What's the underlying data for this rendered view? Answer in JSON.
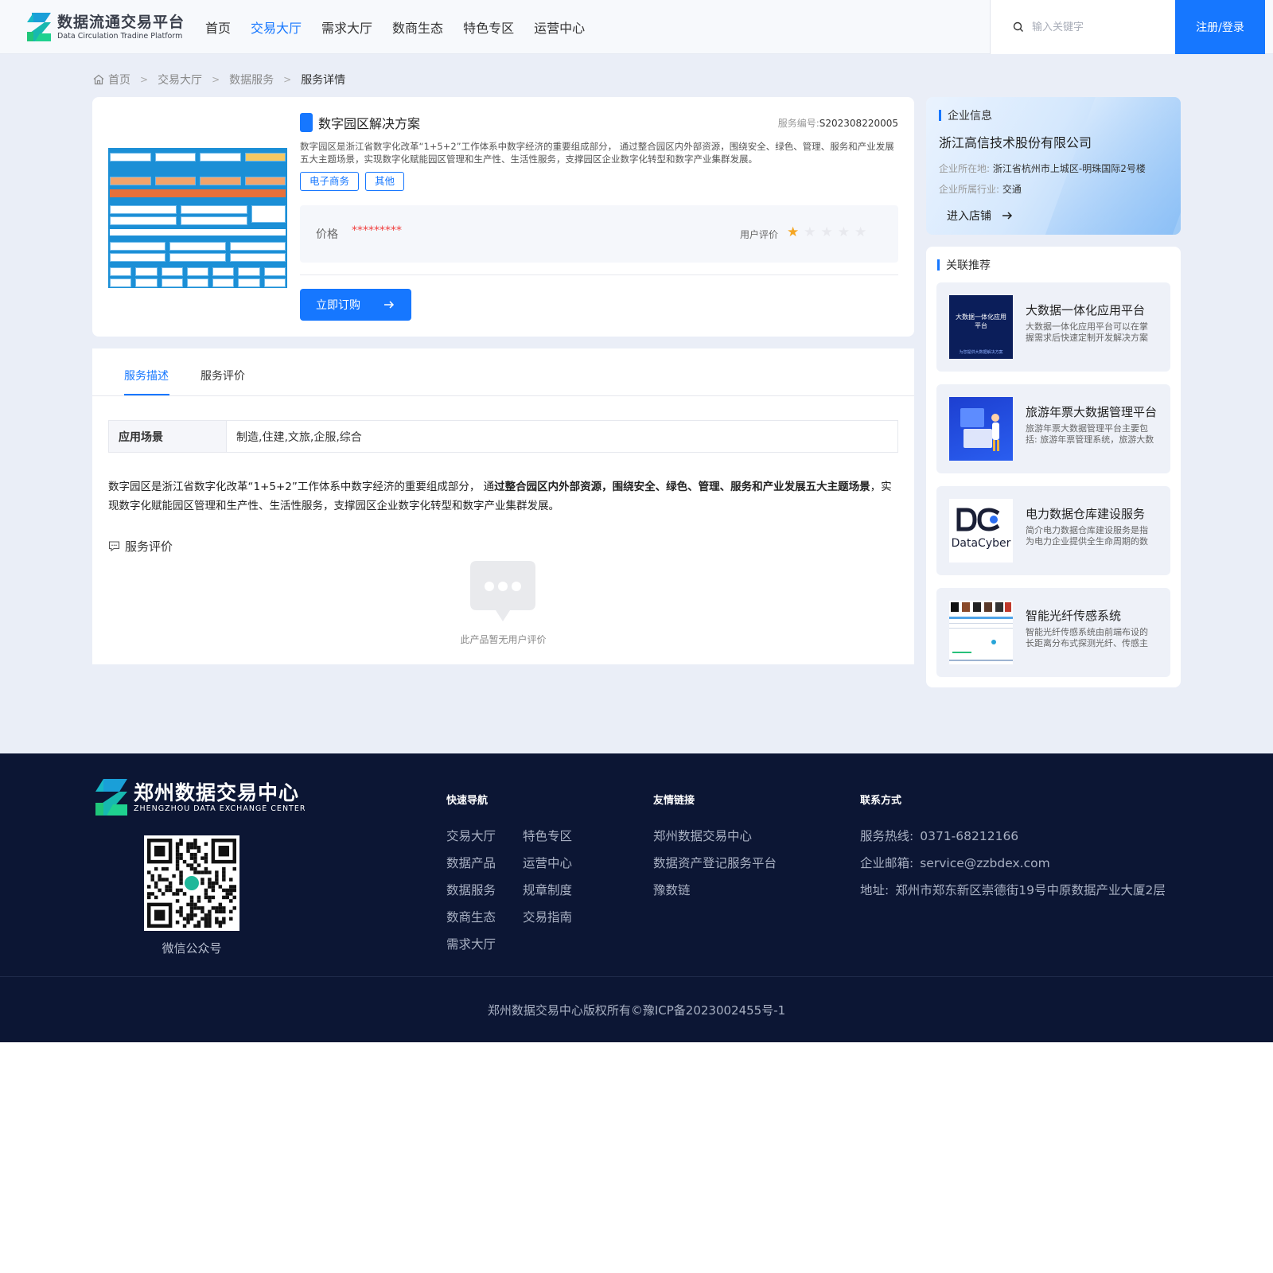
{
  "header": {
    "logo_title": "数据流通交易平台",
    "logo_sub": "Data Circulation Tradine Platform",
    "nav": [
      "首页",
      "交易大厅",
      "需求大厅",
      "数商生态",
      "特色专区",
      "运营中心"
    ],
    "active_nav": "交易大厅",
    "search_placeholder": "输入关键字",
    "login_label": "注册/登录"
  },
  "breadcrumb": [
    "首页",
    "交易大厅",
    "数据服务",
    "服务详情"
  ],
  "product": {
    "title": "数字园区解决方案",
    "service_no_label": "服务编号:",
    "service_no": "S202308220005",
    "description": "数字园区是浙江省数字化改革“1+5+2”工作体系中数字经济的重要组成部分， 通过整合园区内外部资源，围绕安全、绿色、管理、服务和产业发展五大主题场景，实现数字化赋能园区管理和生产性、生活性服务，支撑园区企业数字化转型和数字产业集群发展。",
    "tags": [
      "电子商务",
      "其他"
    ],
    "price_label": "价格",
    "price_value": "*********",
    "rating_label": "用户评价",
    "rating": 1,
    "rating_max": 5,
    "buy_label": "立即订购"
  },
  "company": {
    "section_title": "企业信息",
    "name": "浙江高信技术股份有限公司",
    "location_label": "企业所在地:",
    "location": "浙江省杭州市上城区-明珠国际2号楼",
    "industry_label": "企业所属行业:",
    "industry": "交通",
    "enter_label": "进入店铺"
  },
  "tabs": [
    "服务描述",
    "服务评价"
  ],
  "active_tab": "服务描述",
  "scene": {
    "label": "应用场景",
    "value": "制造,住建,文旅,企服,综合"
  },
  "detail": {
    "para_part1": "数字园区是浙江省数字化改革“1+5+2”工作体系中数字经济的重要组成部分， 通",
    "para_bold": "过整合园区内外部资源，围绕安全、绿色、管理、服务和产业发展五大主题场景",
    "para_part2": "，实现数字化赋能园区管理和生产性、生活性服务，支撑园区企业数字化转型和数字产业集群发展。"
  },
  "evaluation": {
    "title": "服务评价",
    "empty_text": "此产品暂无用户评价"
  },
  "recommendations": {
    "section_title": "关联推荐",
    "items": [
      {
        "title": "大数据一体化应用平台",
        "desc": "大数据一体化应用平台可以在掌握需求后快速定制开发解决方案",
        "thumb_text": "大数据一体化应用平台",
        "thumb_caption": "为您提供大数据解决方案"
      },
      {
        "title": "旅游年票大数据管理平台",
        "desc": "旅游年票大数据管理平台主要包括: 旅游年票管理系统，旅游大数据分析系统"
      },
      {
        "title": "电力数据仓库建设服务",
        "desc": "简介电力数据仓库建设服务是指为电力企业提供全生命周期的数据仓库服务",
        "thumb_text": "DataCyber"
      },
      {
        "title": "智能光纤传感系统",
        "desc": "智能光纤传感系统由前端布设的长距离分布式探测光纤、传感主机组成"
      }
    ]
  },
  "footer": {
    "logo_title": "郑州数据交易中心",
    "logo_sub": "ZHENGZHOU DATA EXCHANGE CENTER",
    "qr_label": "微信公众号",
    "quick_nav_title": "快速导航",
    "quick_nav_col1": [
      "交易大厅",
      "数据产品",
      "数据服务",
      "数商生态",
      "需求大厅"
    ],
    "quick_nav_col2": [
      "特色专区",
      "运营中心",
      "规章制度",
      "交易指南"
    ],
    "links_title": "友情链接",
    "links": [
      "郑州数据交易中心",
      "数据资产登记服务平台",
      "豫数链"
    ],
    "contact_title": "联系方式",
    "contact": [
      {
        "label": "服务热线:",
        "value": "0371-68212166"
      },
      {
        "label": "企业邮箱:",
        "value": "service@zzbdex.com"
      },
      {
        "label": "地址:",
        "value": "郑州市郑东新区崇德街19号中原数据产业大厦2层"
      }
    ],
    "copyright": "郑州数据交易中心版权所有©豫ICP备2023002455号-1"
  },
  "colors": {
    "primary": "#1677ff",
    "page_bg": "#eaeef7",
    "footer_bg": "#0c1634",
    "price": "#f04040",
    "star_on": "#f5a623"
  }
}
